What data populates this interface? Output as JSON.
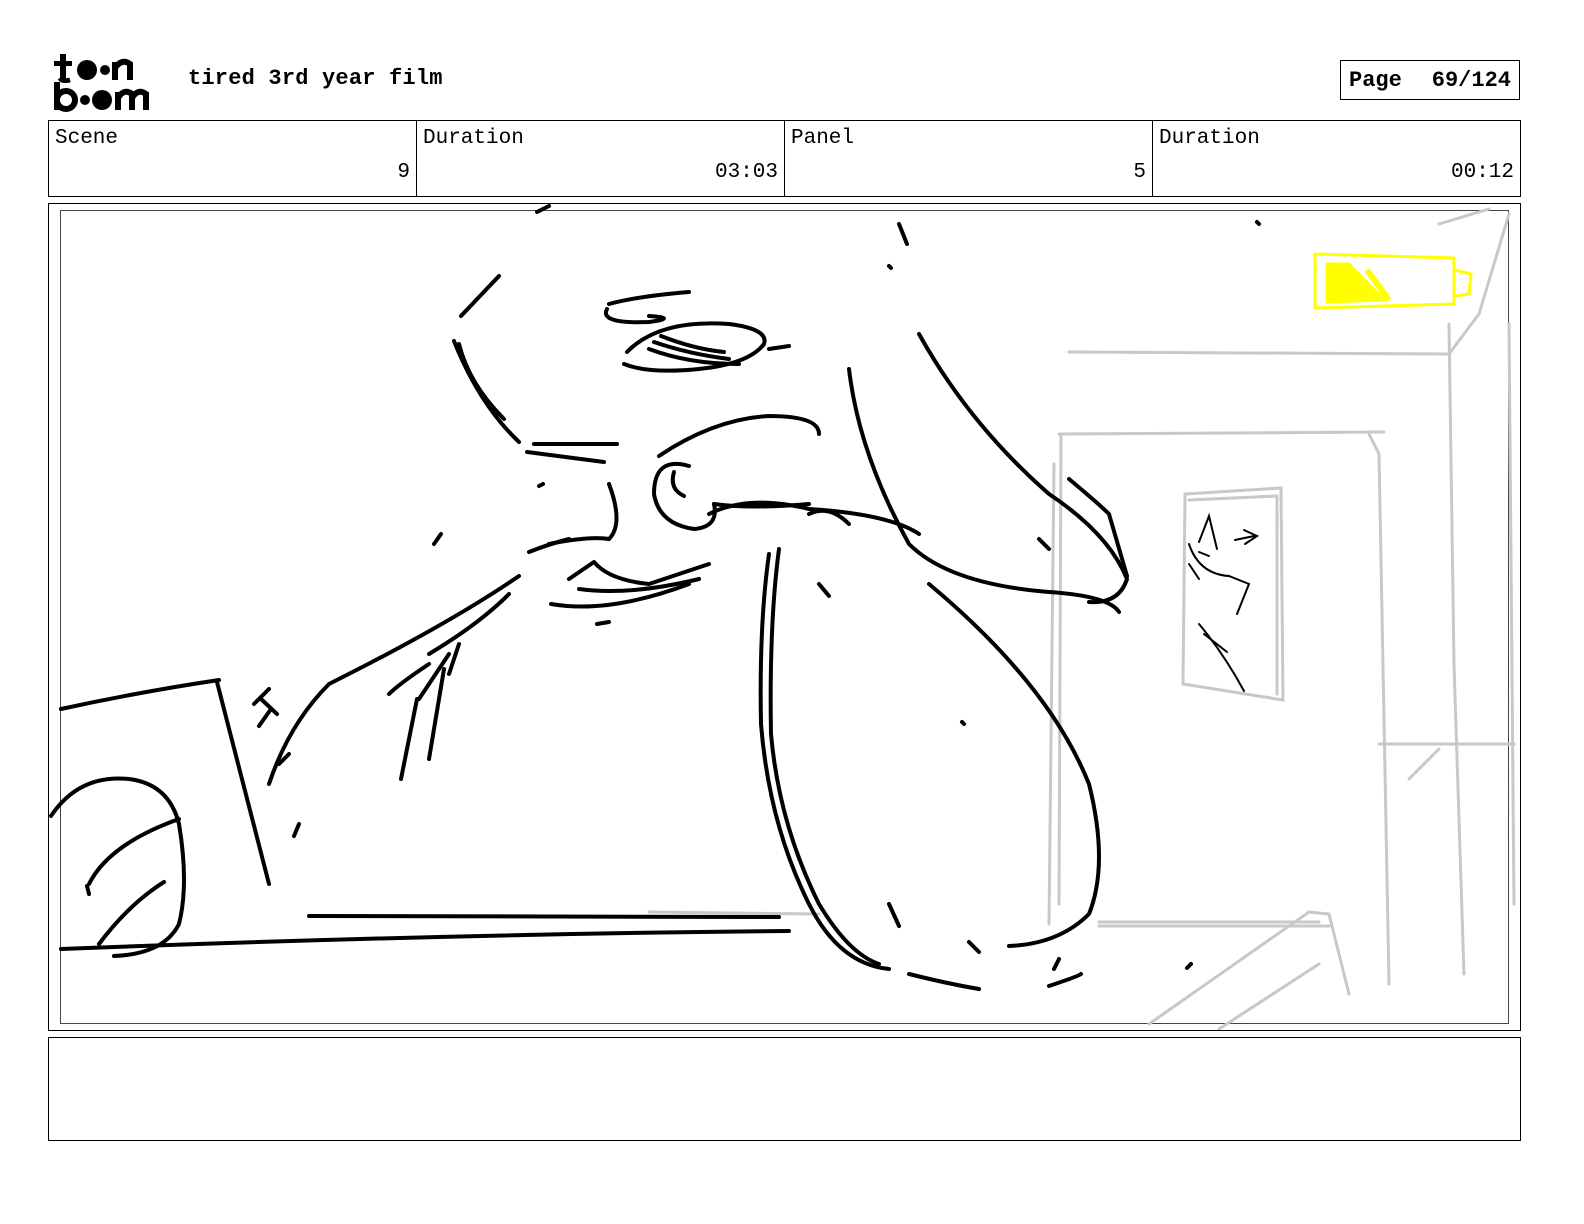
{
  "header": {
    "logo_text_top": "toon",
    "logo_text_bottom": "boom",
    "project_title": "tired 3rd year film",
    "page_label": "Page",
    "page_number": "69/124"
  },
  "info": {
    "scene_label": "Scene",
    "scene_value": "9",
    "scene_duration_label": "Duration",
    "scene_duration_value": "03:03",
    "panel_label": "Panel",
    "panel_value": "5",
    "panel_duration_label": "Duration",
    "panel_duration_value": "00:12"
  },
  "panel": {
    "sketch_line_color": "#000000",
    "background_line_color": "#c8c8c8",
    "highlight_color": "#ffff00"
  },
  "notes": {
    "text": ""
  }
}
